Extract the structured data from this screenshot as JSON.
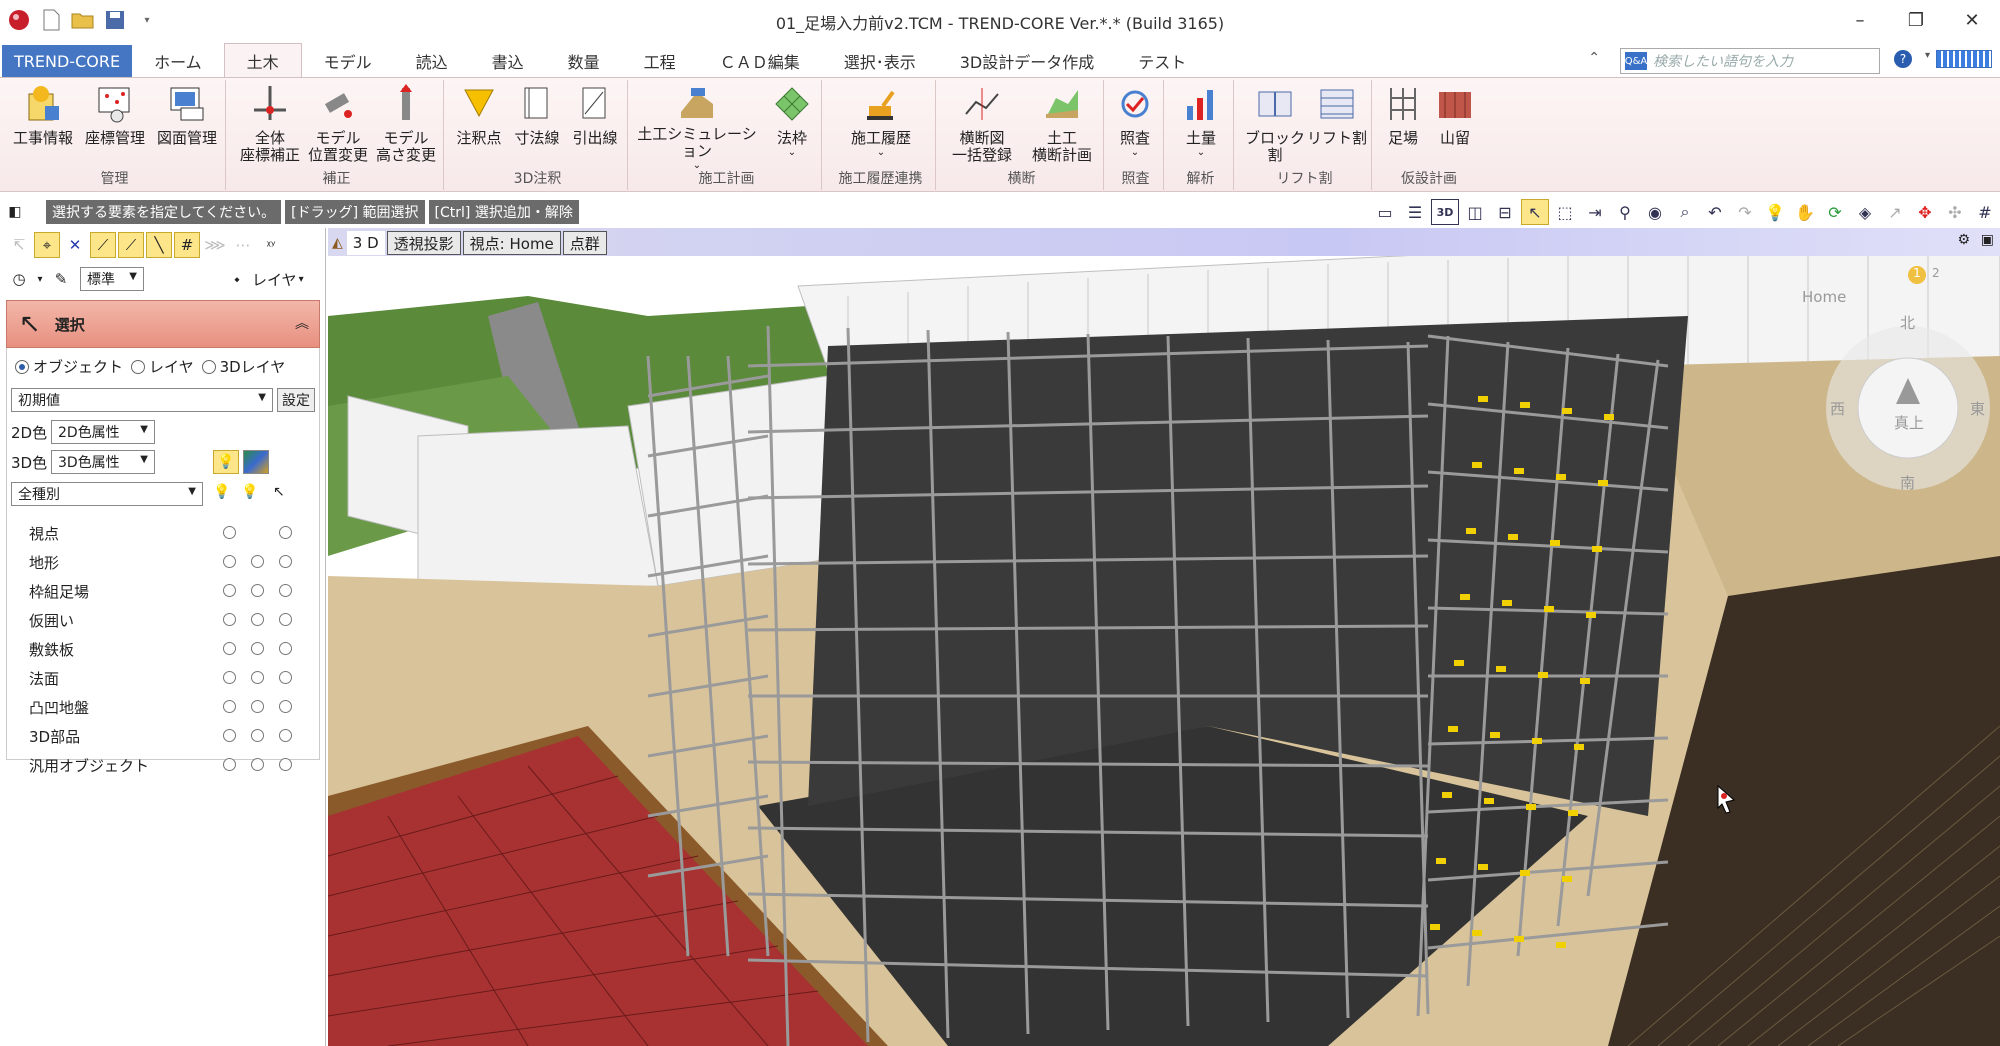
{
  "window": {
    "title": "01_足場入力前v2.TCM - TREND-CORE Ver.*.* (Build 3165)",
    "minimize": "–",
    "maximize": "❐",
    "close": "✕"
  },
  "tabs": {
    "file": "TREND-CORE",
    "items": [
      "ホーム",
      "土木",
      "モデル",
      "読込",
      "書込",
      "数量",
      "工程",
      "ＣＡＤ編集",
      "選択･表示",
      "3D設計データ作成",
      "テスト"
    ],
    "active_index": 1
  },
  "search": {
    "placeholder": "検索したい語句を入力",
    "badge": "Q&A"
  },
  "ribbon": {
    "groups": [
      {
        "label": "管理",
        "buttons": [
          "工事情報",
          "座標管理",
          "図面管理"
        ]
      },
      {
        "label": "補正",
        "buttons": [
          "全体\n座標補正",
          "モデル\n位置変更",
          "モデル\n高さ変更"
        ]
      },
      {
        "label": "3D注釈",
        "buttons": [
          "注釈点",
          "寸法線",
          "引出線"
        ]
      },
      {
        "label": "施工計画",
        "buttons": [
          "土工シミュレーション",
          "法枠"
        ]
      },
      {
        "label": "施工履歴連携",
        "buttons": [
          "施工履歴"
        ]
      },
      {
        "label": "横断",
        "buttons": [
          "横断図\n一括登録",
          "土工\n横断計画"
        ]
      },
      {
        "label": "照査",
        "buttons": [
          "照査"
        ]
      },
      {
        "label": "解析",
        "buttons": [
          "土量"
        ]
      },
      {
        "label": "リフト割",
        "buttons": [
          "ブロック割",
          "リフト割"
        ]
      },
      {
        "label": "仮設計画",
        "buttons": [
          "足場",
          "山留"
        ]
      }
    ]
  },
  "hints": [
    "選択する要素を指定してください。",
    "[ドラッグ] 範囲選択",
    "[Ctrl] 選択追加・解除"
  ],
  "left_panel": {
    "style_dropdown": "標準",
    "layer_button": "レイヤ",
    "select_title": "選択",
    "radio_options": [
      "オブジェクト",
      "レイヤ",
      "3Dレイヤ"
    ],
    "radio_selected": 0,
    "preset_dropdown": "初期値",
    "settings_button": "設定",
    "color2d_label": "2D色",
    "color2d_value": "2D色属性",
    "color3d_label": "3D色",
    "color3d_value": "3D色属性",
    "kind_dropdown": "全種別",
    "categories": [
      "視点",
      "地形",
      "枠組足場",
      "仮囲い",
      "敷鉄板",
      "法面",
      "凸凹地盤",
      "3D部品",
      "汎用オブジェクト"
    ]
  },
  "viewport": {
    "tabs": [
      "3 D",
      "透視投影",
      "視点: Home",
      "点群"
    ],
    "nav": {
      "home": "Home",
      "north": "北",
      "south": "南",
      "west": "西",
      "east": "東",
      "top": "真上",
      "page1": "1",
      "page2": "2"
    }
  },
  "colors": {
    "file_tab": "#4576c4",
    "ribbon_bg": "#f7e9e9",
    "select_header": "#e89080",
    "view_topbar": "#c8c8f4",
    "scaffold": "#9a9a9a",
    "red_plate": "#a83232",
    "dark_floor": "#333333",
    "fence": "#f2f2f2"
  }
}
